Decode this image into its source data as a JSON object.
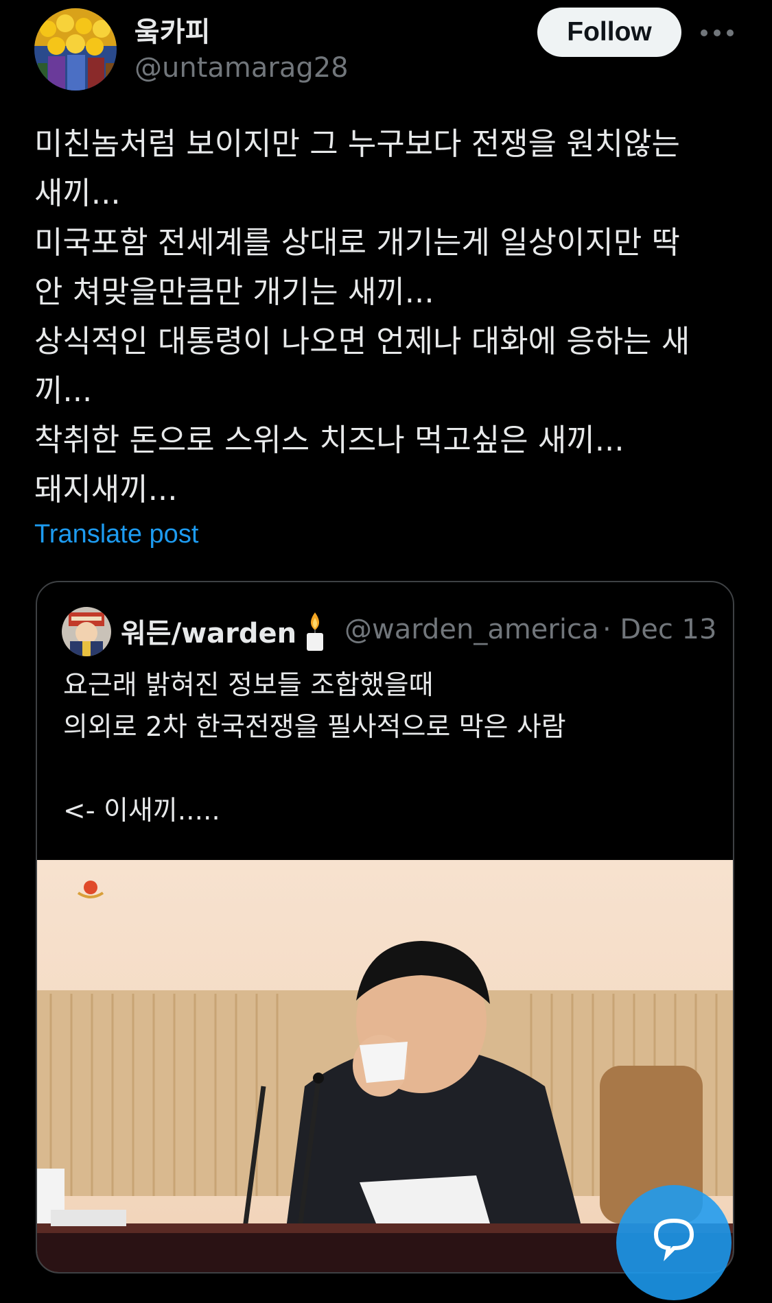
{
  "author": {
    "display_name": "웈카피",
    "handle": "@untamarag28",
    "avatar_icon": "avatar-image"
  },
  "follow_label": "Follow",
  "more_icon": "more-horizontal-icon",
  "post": {
    "lines": [
      "미친놈처럼 보이지만 그 누구보다 전쟁을 원치않는",
      "새끼...",
      "미국포함 전세계를 상대로 개기는게 일상이지만 딱",
      "안 쳐맞을만큼만 개기는 새끼...",
      "상식적인 대통령이 나오면 언제나 대화에 응하는 새",
      "끼...",
      "착취한 돈으로 스위스 치즈나 먹고싶은 새끼...",
      "돼지새끼..."
    ],
    "translate_label": "Translate post"
  },
  "quote": {
    "display_name": "워든/warden",
    "handle": "@warden_america",
    "date": "· Dec 13",
    "candle_icon": "candle-icon",
    "lines": [
      "요근래 밝혀진 정보들 조합했을때",
      "의외로 2차 한국전쟁을 필사적으로 막은 사람",
      "",
      "<- 이새끼....."
    ],
    "image_icon": "news-photo-image"
  },
  "fab_icon": "compose-icon",
  "colors": {
    "background": "#000000",
    "text_primary": "#e7e9ea",
    "text_secondary": "#71767b",
    "link": "#1d9bf0",
    "border": "#3e4144",
    "follow_bg": "#eff3f4"
  }
}
